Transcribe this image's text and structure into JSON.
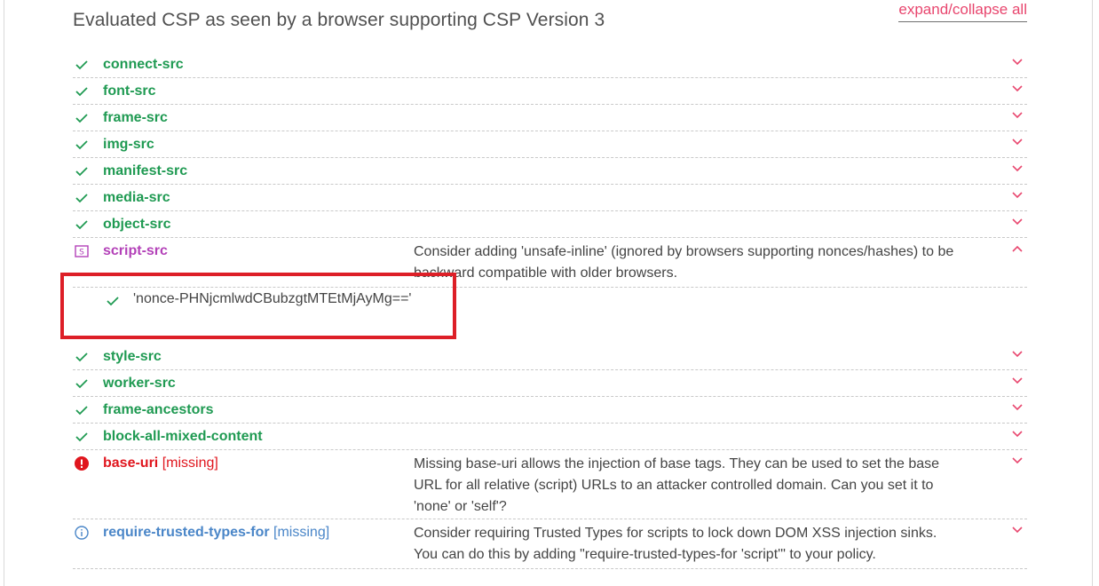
{
  "header": {
    "title": "Evaluated CSP as seen by a browser supporting CSP Version 3",
    "expand_label": "expand/collapse all"
  },
  "directives": [
    {
      "name": "connect-src",
      "status": "ok"
    },
    {
      "name": "font-src",
      "status": "ok"
    },
    {
      "name": "frame-src",
      "status": "ok"
    },
    {
      "name": "img-src",
      "status": "ok"
    },
    {
      "name": "manifest-src",
      "status": "ok"
    },
    {
      "name": "media-src",
      "status": "ok"
    },
    {
      "name": "object-src",
      "status": "ok"
    },
    {
      "name": "script-src",
      "status": "info-purple",
      "expanded": true,
      "description": "Consider adding 'unsafe-inline' (ignored by browsers supporting nonces/hashes) to be backward compatible with older browsers.",
      "values": [
        "'nonce-PHNjcmlwdCBubzgtMTEtMjAyMg=='"
      ]
    },
    {
      "name": "style-src",
      "status": "ok"
    },
    {
      "name": "worker-src",
      "status": "ok"
    },
    {
      "name": "frame-ancestors",
      "status": "ok"
    },
    {
      "name": "block-all-mixed-content",
      "status": "ok"
    },
    {
      "name": "base-uri",
      "status": "error",
      "missing_label": "[missing]",
      "description": "Missing base-uri allows the injection of base tags. They can be used to set the base URL for all relative (script) URLs to an attacker controlled domain. Can you set it to 'none' or 'self'?"
    },
    {
      "name": "require-trusted-types-for",
      "status": "info",
      "missing_label": "[missing]",
      "description": "Consider requiring Trusted Types for scripts to lock down DOM XSS injection sinks. You can do this by adding \"require-trusted-types-for 'script'\" to your policy."
    }
  ],
  "colors": {
    "ok": "#1f9a52",
    "purple": "#b341b8",
    "error": "#e0161e",
    "info": "#4a86c8",
    "accent": "#e8466e",
    "highlight": "#dd1f27"
  }
}
